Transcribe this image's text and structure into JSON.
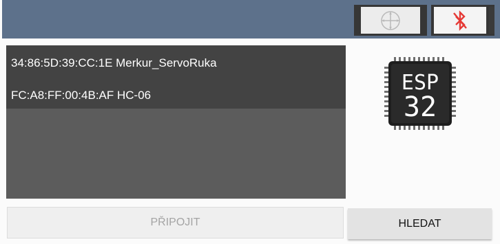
{
  "toolbar": {
    "move_icon": "crosshair-move-icon",
    "bluetooth_icon": "bluetooth-disabled-icon",
    "bar_color": "#5d718b",
    "bluetooth_icon_color": "#e53935"
  },
  "device_list": {
    "items": [
      "34:86:5D:39:CC:1E Merkur_ServoRuka",
      "FC:A8:FF:00:4B:AF HC-06"
    ]
  },
  "chip": {
    "line1": "ESP",
    "line2": "32"
  },
  "buttons": {
    "connect_label": "PŘIPOJIT",
    "search_label": "HLEDAT"
  }
}
